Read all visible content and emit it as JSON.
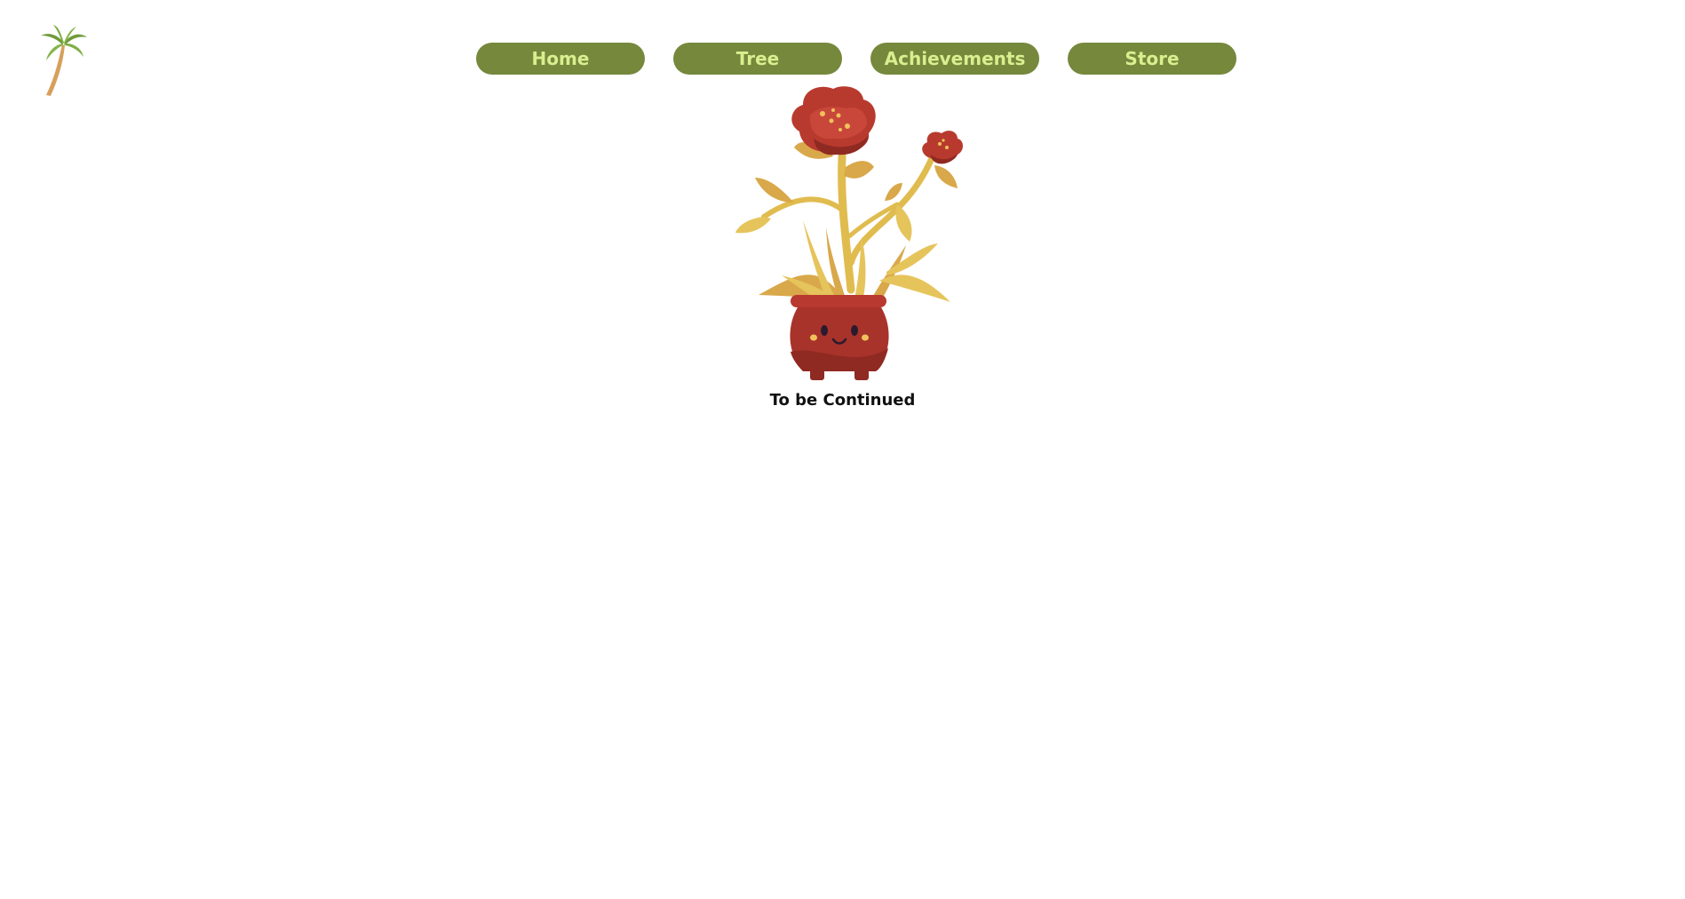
{
  "nav": {
    "items": [
      {
        "label": "Home"
      },
      {
        "label": "Tree"
      },
      {
        "label": "Achievements"
      },
      {
        "label": "Store"
      }
    ]
  },
  "main": {
    "message": "To be Continued"
  },
  "colors": {
    "nav_button_bg": "#75883c",
    "nav_button_text": "#d9ef8f",
    "pot": "#a8332b",
    "flower": "#b83a2e",
    "leaf": "#e2bf55"
  },
  "icons": {
    "logo": "palm-tree-icon",
    "hero": "potted-flower-illustration"
  }
}
